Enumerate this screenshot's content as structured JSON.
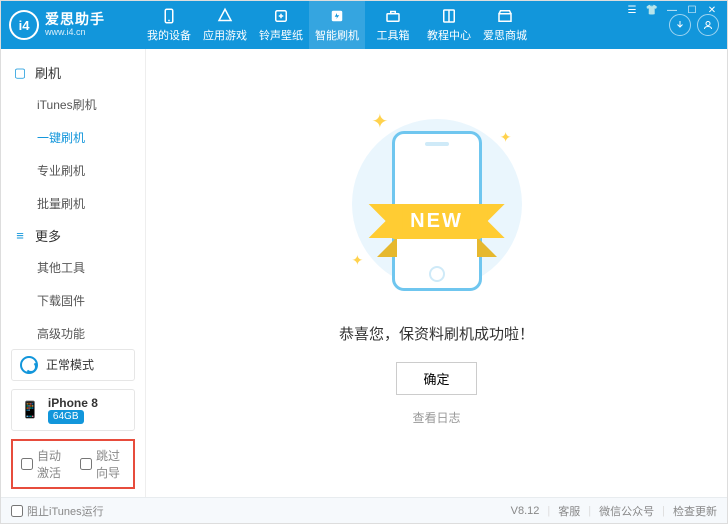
{
  "header": {
    "brand": "爱思助手",
    "url": "www.i4.cn",
    "tabs": [
      {
        "label": "我的设备",
        "icon": "phone"
      },
      {
        "label": "应用游戏",
        "icon": "apps"
      },
      {
        "label": "铃声壁纸",
        "icon": "music"
      },
      {
        "label": "智能刷机",
        "icon": "flash"
      },
      {
        "label": "工具箱",
        "icon": "toolbox"
      },
      {
        "label": "教程中心",
        "icon": "book"
      },
      {
        "label": "爱思商城",
        "icon": "store"
      }
    ],
    "active_tab_index": 3
  },
  "sidebar": {
    "group_flash": {
      "title": "刷机"
    },
    "flash_items": [
      {
        "label": "iTunes刷机"
      },
      {
        "label": "一键刷机"
      },
      {
        "label": "专业刷机"
      },
      {
        "label": "批量刷机"
      }
    ],
    "flash_active_index": 1,
    "group_more": {
      "title": "更多"
    },
    "more_items": [
      {
        "label": "其他工具"
      },
      {
        "label": "下载固件"
      },
      {
        "label": "高级功能"
      }
    ],
    "mode": {
      "label": "正常模式"
    },
    "device": {
      "name": "iPhone 8",
      "storage": "64GB"
    },
    "opts": {
      "auto_activate": "自动激活",
      "skip_guide": "跳过向导"
    }
  },
  "main": {
    "ribbon_text": "NEW",
    "success_text": "恭喜您，保资料刷机成功啦！",
    "confirm_label": "确定",
    "log_link": "查看日志"
  },
  "footer": {
    "block_itunes": "阻止iTunes运行",
    "version": "V8.12",
    "support": "客服",
    "wechat": "微信公众号",
    "update": "检查更新"
  }
}
